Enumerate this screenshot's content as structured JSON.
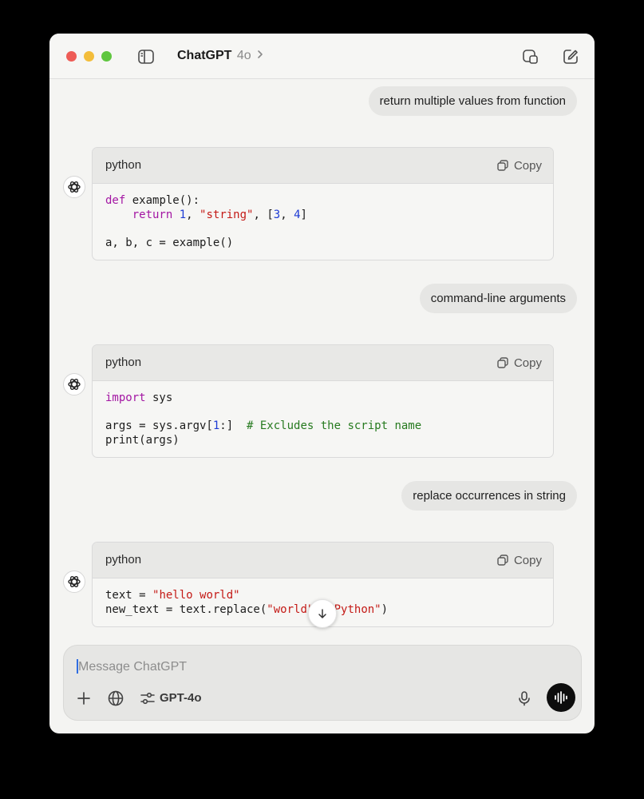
{
  "window": {
    "title": "ChatGPT",
    "model": "4o"
  },
  "messages": [
    {
      "role": "user",
      "text": "return multiple values from function"
    },
    {
      "role": "assistant",
      "language": "python",
      "copy_label": "Copy",
      "code": "def example():\n    return 1, \"string\", [3, 4]\n\na, b, c = example()"
    },
    {
      "role": "user",
      "text": "command-line arguments"
    },
    {
      "role": "assistant",
      "language": "python",
      "copy_label": "Copy",
      "code": "import sys\n\nargs = sys.argv[1:]  # Excludes the script name\nprint(args)"
    },
    {
      "role": "user",
      "text": "replace occurrences in string"
    },
    {
      "role": "assistant",
      "language": "python",
      "copy_label": "Copy",
      "code": "text = \"hello world\"\nnew_text = text.replace(\"world\", \"Python\")"
    }
  ],
  "composer": {
    "placeholder": "Message ChatGPT",
    "model_label": "GPT-4o"
  },
  "icons": {
    "sidebar": "sidebar-toggle-icon",
    "new_window": "new-window-icon",
    "compose": "compose-icon",
    "copy": "copy-icon",
    "plus": "plus-icon",
    "globe": "globe-icon",
    "sliders": "sliders-icon",
    "mic": "microphone-icon",
    "voice": "voice-mode-icon",
    "scroll": "arrow-down-icon"
  },
  "colors": {
    "keyword": "#a316a3",
    "number": "#1d3bd4",
    "string": "#c41a16",
    "comment": "#267a1f"
  }
}
